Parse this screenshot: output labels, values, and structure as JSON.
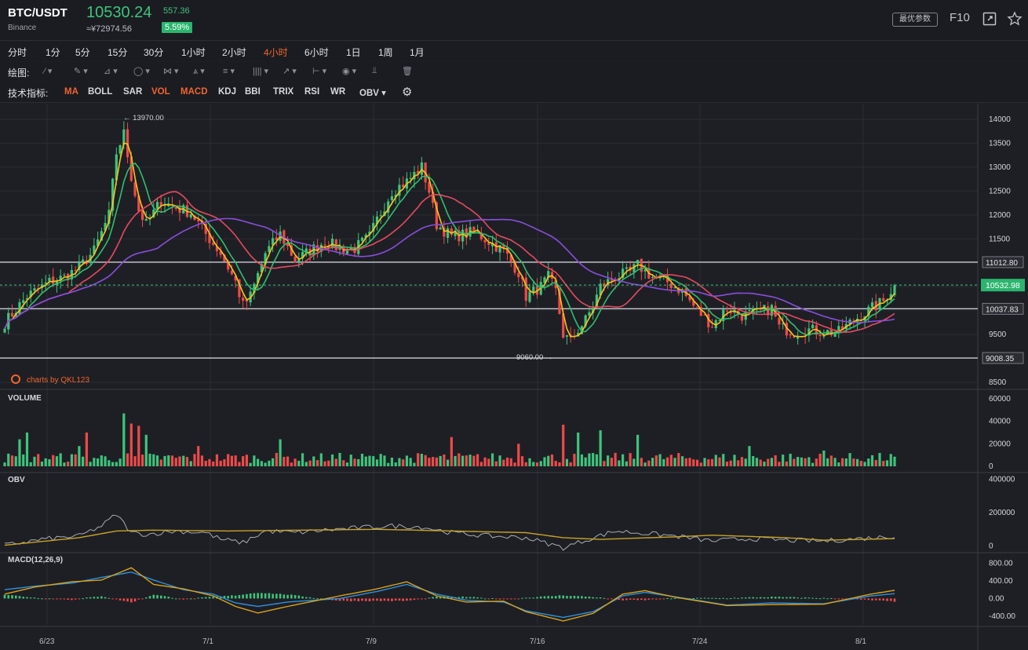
{
  "header": {
    "pair": "BTC/USDT",
    "exchange": "Binance",
    "price": "10530.24",
    "change": "557.36",
    "cny": "≈¥72974.56",
    "percent": "5.59%",
    "best_params": "最优参数",
    "f10": "F10",
    "icons": [
      "expand-icon",
      "star-icon"
    ]
  },
  "periods": [
    {
      "label": "分时",
      "active": false
    },
    {
      "label": "1分",
      "active": false
    },
    {
      "label": "5分",
      "active": false
    },
    {
      "label": "15分",
      "active": false
    },
    {
      "label": "30分",
      "active": false
    },
    {
      "label": "1小时",
      "active": false
    },
    {
      "label": "2小时",
      "active": false
    },
    {
      "label": "4小时",
      "active": true
    },
    {
      "label": "6小时",
      "active": false
    },
    {
      "label": "1日",
      "active": false
    },
    {
      "label": "1周",
      "active": false
    },
    {
      "label": "1月",
      "active": false
    }
  ],
  "drawing": {
    "label": "绘图:",
    "tools": [
      "line-tool",
      "pen-tool",
      "channel-tool",
      "circle-tool",
      "fib-tool",
      "pattern-tool",
      "text-tool",
      "grid-tool",
      "arrow-tool",
      "measure-tool",
      "eye-tool",
      "magnet-tool",
      "trash-tool"
    ]
  },
  "indicators": {
    "label": "技术指标:",
    "items": [
      {
        "label": "MA",
        "active": true
      },
      {
        "label": "BOLL",
        "active": false
      },
      {
        "label": "SAR",
        "active": false
      },
      {
        "label": "VOL",
        "active": true
      },
      {
        "label": "MACD",
        "active": true
      },
      {
        "label": "KDJ",
        "active": false
      },
      {
        "label": "BBI",
        "active": false
      },
      {
        "label": "TRIX",
        "active": false
      },
      {
        "label": "RSI",
        "active": false
      },
      {
        "label": "WR",
        "active": false
      },
      {
        "label": "OBV",
        "active": false
      }
    ],
    "settings_icon": "gear-icon"
  },
  "colors": {
    "up": "#3ec47c",
    "down": "#ef4a4a",
    "ma5": "#f5c518",
    "ma10": "#2fbf71",
    "ma30": "#e64a60",
    "ma60": "#8a4dde",
    "macd_dif": "#2f8fe0",
    "macd_dea": "#d9a21b",
    "obv": "#a7acb5",
    "obv_ma": "#c9a227",
    "current_line": "#3ec47c"
  },
  "chart_data": [
    {
      "type": "candlestick",
      "title": "",
      "y_ticks": [
        "14000",
        "13500",
        "13000",
        "12500",
        "12000",
        "11500",
        "11000",
        "10500",
        "10000",
        "9500",
        "9000",
        "8500"
      ],
      "ylim": [
        8500,
        14000
      ],
      "x_ticks": [
        "6/23",
        "7/1",
        "7/9",
        "7/16",
        "7/24",
        "8/1"
      ],
      "high_annotation": "← 13970.00",
      "low_annotation": "9060.00 →",
      "horizontal_levels": [
        "11012.80",
        "10037.83",
        "9008.35"
      ],
      "current_price_label": "10532.98",
      "ma_series": [
        "MA5",
        "MA10",
        "MA30",
        "MA60"
      ],
      "watermark": "charts by QKL123",
      "close_path": [
        [
          0,
          9750
        ],
        [
          6,
          10300
        ],
        [
          12,
          10600
        ],
        [
          16,
          10700
        ],
        [
          20,
          10900
        ],
        [
          24,
          11250
        ],
        [
          28,
          12000
        ],
        [
          30,
          13300
        ],
        [
          32,
          13700
        ],
        [
          34,
          12800
        ],
        [
          36,
          12100
        ],
        [
          38,
          11800
        ],
        [
          42,
          12300
        ],
        [
          46,
          12150
        ],
        [
          50,
          12050
        ],
        [
          54,
          11600
        ],
        [
          58,
          11200
        ],
        [
          62,
          10600
        ],
        [
          64,
          10100
        ],
        [
          66,
          10300
        ],
        [
          70,
          11200
        ],
        [
          74,
          11600
        ],
        [
          78,
          11050
        ],
        [
          82,
          11250
        ],
        [
          86,
          11450
        ],
        [
          90,
          11300
        ],
        [
          94,
          11300
        ],
        [
          98,
          11550
        ],
        [
          100,
          11900
        ],
        [
          104,
          12500
        ],
        [
          108,
          12700
        ],
        [
          112,
          13000
        ],
        [
          114,
          12500
        ],
        [
          116,
          11800
        ],
        [
          120,
          11550
        ],
        [
          124,
          11600
        ],
        [
          126,
          11650
        ],
        [
          130,
          11450
        ],
        [
          134,
          11250
        ],
        [
          138,
          10800
        ],
        [
          140,
          10300
        ],
        [
          144,
          10500
        ],
        [
          146,
          10700
        ],
        [
          148,
          10400
        ],
        [
          150,
          9500
        ],
        [
          152,
          9350
        ],
        [
          154,
          9600
        ],
        [
          156,
          9800
        ],
        [
          158,
          10100
        ],
        [
          160,
          10500
        ],
        [
          164,
          10700
        ],
        [
          168,
          10800
        ],
        [
          170,
          10950
        ],
        [
          174,
          10700
        ],
        [
          178,
          10600
        ],
        [
          182,
          10400
        ],
        [
          186,
          10000
        ],
        [
          190,
          9700
        ],
        [
          194,
          10050
        ],
        [
          198,
          9900
        ],
        [
          202,
          9950
        ],
        [
          206,
          10050
        ],
        [
          208,
          9650
        ],
        [
          212,
          9550
        ],
        [
          216,
          9600
        ],
        [
          220,
          9550
        ],
        [
          224,
          9550
        ],
        [
          228,
          9800
        ],
        [
          232,
          10000
        ],
        [
          236,
          10200
        ],
        [
          239,
          10530
        ]
      ]
    },
    {
      "type": "bar",
      "title": "VOLUME",
      "y_ticks": [
        "60000",
        "40000",
        "20000",
        "0"
      ],
      "ylim": [
        0,
        60000
      ],
      "spikes": [
        [
          4,
          24000
        ],
        [
          6,
          30000
        ],
        [
          20,
          18000
        ],
        [
          22,
          30000
        ],
        [
          32,
          47000
        ],
        [
          34,
          38000
        ],
        [
          36,
          36000
        ],
        [
          38,
          28000
        ],
        [
          52,
          18000
        ],
        [
          74,
          24000
        ],
        [
          120,
          26000
        ],
        [
          138,
          20000
        ],
        [
          150,
          37000
        ],
        [
          154,
          30000
        ],
        [
          160,
          32000
        ],
        [
          170,
          28000
        ],
        [
          200,
          18000
        ],
        [
          220,
          14000
        ],
        [
          240,
          12000
        ]
      ]
    },
    {
      "type": "line",
      "title": "OBV",
      "y_ticks": [
        "400000",
        "200000",
        "0"
      ],
      "ylim": [
        -30000,
        420000
      ],
      "obv_path": [
        [
          0,
          5000
        ],
        [
          10,
          40000
        ],
        [
          20,
          60000
        ],
        [
          26,
          120000
        ],
        [
          30,
          190000
        ],
        [
          34,
          80000
        ],
        [
          38,
          70000
        ],
        [
          46,
          90000
        ],
        [
          54,
          80000
        ],
        [
          58,
          40000
        ],
        [
          64,
          20000
        ],
        [
          70,
          90000
        ],
        [
          78,
          80000
        ],
        [
          86,
          95000
        ],
        [
          96,
          110000
        ],
        [
          104,
          120000
        ],
        [
          112,
          115000
        ],
        [
          120,
          80000
        ],
        [
          130,
          60000
        ],
        [
          140,
          50000
        ],
        [
          150,
          -10000
        ],
        [
          158,
          50000
        ],
        [
          164,
          90000
        ],
        [
          170,
          80000
        ],
        [
          180,
          60000
        ],
        [
          190,
          30000
        ],
        [
          200,
          45000
        ],
        [
          210,
          35000
        ],
        [
          220,
          30000
        ],
        [
          230,
          45000
        ],
        [
          240,
          60000
        ]
      ],
      "obv_ma_path": [
        [
          0,
          5000
        ],
        [
          20,
          50000
        ],
        [
          30,
          90000
        ],
        [
          40,
          95000
        ],
        [
          60,
          90000
        ],
        [
          80,
          95000
        ],
        [
          100,
          100000
        ],
        [
          120,
          90000
        ],
        [
          140,
          80000
        ],
        [
          150,
          50000
        ],
        [
          160,
          40000
        ],
        [
          180,
          55000
        ],
        [
          190,
          65000
        ],
        [
          210,
          50000
        ],
        [
          220,
          35000
        ],
        [
          240,
          45000
        ]
      ]
    },
    {
      "type": "line",
      "title": "MACD(12,26,9)",
      "y_ticks": [
        "800.00",
        "400.00",
        "0.00",
        "-400.00"
      ],
      "ylim": [
        -600,
        900
      ],
      "dif_path": [
        [
          0,
          200
        ],
        [
          8,
          280
        ],
        [
          18,
          350
        ],
        [
          26,
          480
        ],
        [
          34,
          600
        ],
        [
          40,
          420
        ],
        [
          48,
          200
        ],
        [
          56,
          100
        ],
        [
          62,
          -100
        ],
        [
          68,
          -180
        ],
        [
          76,
          -80
        ],
        [
          90,
          0
        ],
        [
          100,
          160
        ],
        [
          108,
          320
        ],
        [
          116,
          100
        ],
        [
          124,
          -40
        ],
        [
          134,
          -80
        ],
        [
          140,
          -280
        ],
        [
          150,
          -430
        ],
        [
          158,
          -300
        ],
        [
          166,
          60
        ],
        [
          172,
          140
        ],
        [
          180,
          40
        ],
        [
          194,
          -150
        ],
        [
          206,
          -100
        ],
        [
          220,
          -120
        ],
        [
          232,
          50
        ],
        [
          240,
          120
        ]
      ],
      "dea_path": [
        [
          0,
          100
        ],
        [
          8,
          260
        ],
        [
          18,
          380
        ],
        [
          26,
          420
        ],
        [
          34,
          700
        ],
        [
          40,
          320
        ],
        [
          48,
          220
        ],
        [
          56,
          60
        ],
        [
          62,
          -180
        ],
        [
          68,
          -330
        ],
        [
          76,
          -180
        ],
        [
          90,
          60
        ],
        [
          100,
          220
        ],
        [
          108,
          380
        ],
        [
          116,
          60
        ],
        [
          124,
          -80
        ],
        [
          134,
          -60
        ],
        [
          140,
          -300
        ],
        [
          150,
          -510
        ],
        [
          158,
          -340
        ],
        [
          166,
          100
        ],
        [
          172,
          180
        ],
        [
          180,
          30
        ],
        [
          194,
          -160
        ],
        [
          206,
          -140
        ],
        [
          220,
          -130
        ],
        [
          232,
          90
        ],
        [
          240,
          200
        ]
      ]
    }
  ]
}
